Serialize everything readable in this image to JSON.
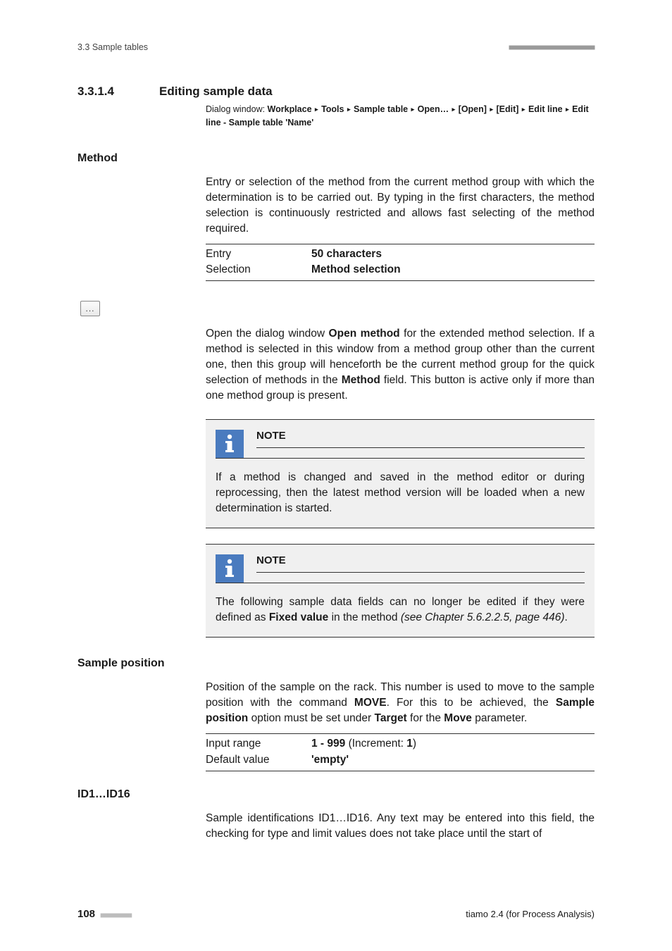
{
  "header": {
    "running": "3.3 Sample tables"
  },
  "section": {
    "number": "3.3.1.4",
    "title": "Editing sample data",
    "dialog_label": "Dialog window: ",
    "path": [
      "Workplace",
      "Tools",
      "Sample table",
      "Open…",
      "[Open]",
      "[Edit]",
      "Edit line",
      "Edit line - Sample table 'Name'"
    ]
  },
  "method": {
    "label": "Method",
    "desc": "Entry or selection of the method from the current method group with which the determination is to be carried out. By typing in the first characters, the method selection is continuously restricted and allows fast selecting of the method required.",
    "rows": [
      {
        "k": "Entry",
        "v_bold": "50 characters",
        "v_rest": ""
      },
      {
        "k": "Selection",
        "v_bold": "Method selection",
        "v_rest": ""
      }
    ],
    "more_desc_a": "Open the dialog window ",
    "more_desc_b": "Open method",
    "more_desc_c": " for the extended method selection. If a method is selected in this window from a method group other than the current one, then this group will henceforth be the current method group for the quick selection of methods in the ",
    "more_desc_d": "Method",
    "more_desc_e": " field. This button is active only if more than one method group is present."
  },
  "note1": {
    "title": "NOTE",
    "body": "If a method is changed and saved in the method editor or during reprocessing, then the latest method version will be loaded when a new determination is started."
  },
  "note2": {
    "title": "NOTE",
    "body_a": "The following sample data fields can no longer be edited if they were defined as ",
    "body_b": "Fixed value",
    "body_c": " in the method ",
    "body_d": "(see Chapter 5.6.2.2.5, page 446)",
    "body_e": "."
  },
  "sample_position": {
    "label": "Sample position",
    "desc_a": "Position of the sample on the rack. This number is used to move to the sample position with the command ",
    "desc_b": "MOVE",
    "desc_c": ". For this to be achieved, the ",
    "desc_d": "Sample position",
    "desc_e": " option must be set under ",
    "desc_f": "Target",
    "desc_g": " for the ",
    "desc_h": "Move",
    "desc_i": " parameter.",
    "rows": [
      {
        "k": "Input range",
        "v_bold": "1 - 999",
        "v_rest": "  (Increment: ",
        "v_bold2": "1",
        "v_rest2": ")"
      },
      {
        "k": "Default value",
        "v_bold": "'empty'",
        "v_rest": ""
      }
    ]
  },
  "id": {
    "label": "ID1…ID16",
    "desc": "Sample identifications ID1…ID16. Any text may be entered into this field, the checking for type and limit values does not take place until the start of"
  },
  "footer": {
    "page": "108",
    "product": "tiamo 2.4 (for Process Analysis)"
  }
}
